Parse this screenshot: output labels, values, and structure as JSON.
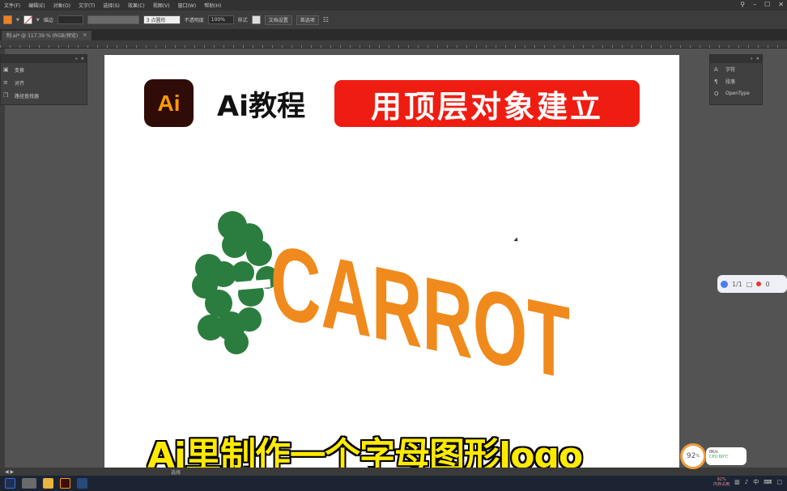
{
  "menubar": {
    "items": [
      "文件(F)",
      "编辑(E)",
      "对象(O)",
      "文字(T)",
      "选择(S)",
      "效果(C)",
      "视图(V)",
      "窗口(W)",
      "帮助(H)"
    ]
  },
  "controlbar": {
    "stroke_label": "描边",
    "brush_value": "3 点圆形",
    "opacity_label": "不透明度",
    "opacity_value": "100%",
    "style_label": "样式",
    "doc_settings": "文档设置",
    "preferences": "首选项"
  },
  "doctab": {
    "title": "制.ai* @ 117.39 % (RGB/预览)",
    "close": "×"
  },
  "left_panel": {
    "items": [
      {
        "icon": "transform-icon",
        "label": "变换"
      },
      {
        "icon": "align-icon",
        "label": "对齐"
      },
      {
        "icon": "pathfinder-icon",
        "label": "路径查找器"
      }
    ]
  },
  "right_panel": {
    "items": [
      {
        "icon": "character-icon",
        "label": "字符"
      },
      {
        "icon": "paragraph-icon",
        "label": "段落"
      },
      {
        "icon": "opentype-icon",
        "label": "OpenType"
      }
    ]
  },
  "artboard": {
    "logo_text": "Ai",
    "tutorial_title": "Ai教程",
    "banner_text": "用顶层对象建立",
    "carrot_text": "CARROT",
    "caption": "Ai里制作一个字母图形logo"
  },
  "page_widget": {
    "page": "1/1",
    "count": "0"
  },
  "statusbar": {
    "tool": "选择"
  },
  "cpu": {
    "percent": "92",
    "unit": "%",
    "line1": "0K/s",
    "line2": "CPU 60℃"
  },
  "tray": {
    "lang": "中",
    "sys_line1": "92%",
    "sys_line2": "内存占用"
  },
  "colors": {
    "accent_orange": "#f08a1c",
    "leaf_green": "#2a7d3e",
    "banner_red": "#ef1c12",
    "caption_yellow": "#ffea00"
  }
}
